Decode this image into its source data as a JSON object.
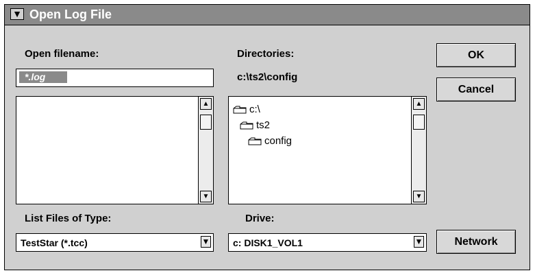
{
  "window": {
    "title": "Open Log File",
    "system_menu_glyph": "▼"
  },
  "filename": {
    "label": "Open filename:",
    "value": "*.log"
  },
  "directories": {
    "label": "Directories:",
    "current_path": "c:\\ts2\\config",
    "items": [
      "c:\\",
      "ts2",
      "config"
    ]
  },
  "buttons": {
    "ok": "OK",
    "cancel": "Cancel",
    "network": "Network"
  },
  "file_type": {
    "label": "List Files of Type:",
    "value": "TestStar (*.tcc)"
  },
  "drive": {
    "label": "Drive:",
    "value": "c: DISK1_VOL1"
  },
  "icons": {
    "scroll_up": "▲",
    "scroll_down": "▼",
    "combo_arrow": "▼",
    "folder": "folder-icon"
  }
}
